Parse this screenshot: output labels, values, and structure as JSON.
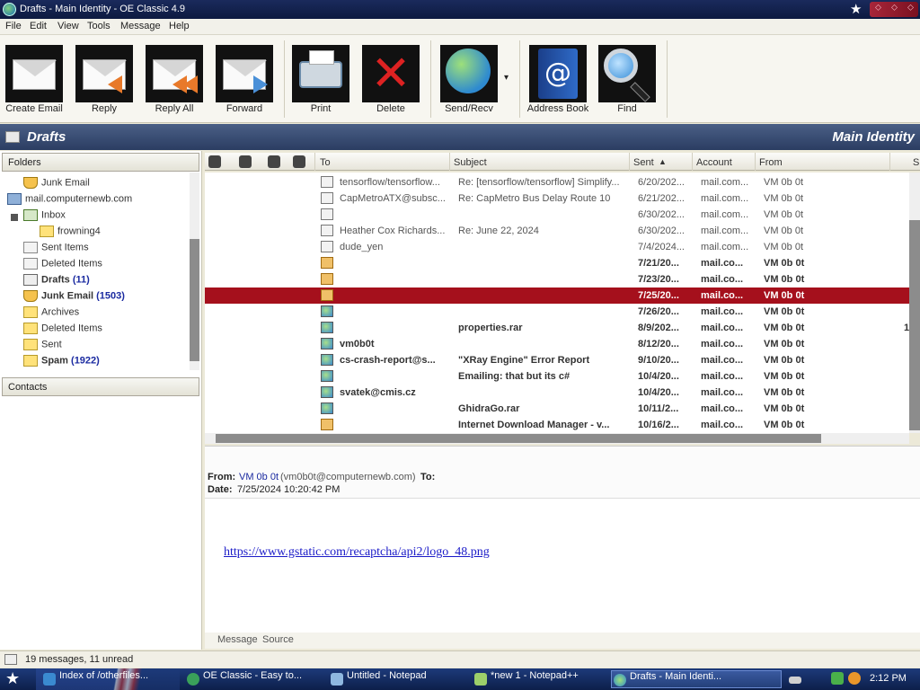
{
  "window": {
    "title": "Drafts - Main Identity - OE Classic 4.9",
    "star_glyph": "★",
    "controls": [
      "⬦",
      "⬦",
      "⬦"
    ]
  },
  "menu": [
    "File",
    "Edit",
    "View",
    "Tools",
    "Message",
    "Help"
  ],
  "toolbar": {
    "create_email": "Create Email",
    "reply": "Reply",
    "reply_all": "Reply All",
    "forward": "Forward",
    "print": "Print",
    "delete": "Delete",
    "send_recv": "Send/Recv",
    "address_book": "Address Book",
    "find": "Find",
    "dropdown_glyph": "▾"
  },
  "header": {
    "folder_title": "Drafts",
    "identity": "Main Identity"
  },
  "folders_pane": {
    "title": "Folders",
    "items": [
      {
        "label": "Junk Email",
        "count": "",
        "icon": "junk-icon",
        "bold": false
      },
      {
        "label": "mail.computernewb.com",
        "count": "",
        "icon": "server-icon",
        "bold": false
      },
      {
        "label": "Inbox",
        "count": "",
        "icon": "inbox-icon",
        "bold": false
      },
      {
        "label": "frowning4",
        "count": "",
        "icon": "folder-icon",
        "bold": false
      },
      {
        "label": "Sent Items",
        "count": "",
        "icon": "sent-icon",
        "bold": false
      },
      {
        "label": "Deleted Items",
        "count": "",
        "icon": "deleted-icon",
        "bold": false
      },
      {
        "label": "Drafts",
        "count": "(11)",
        "icon": "drafts-icon",
        "bold": true
      },
      {
        "label": "Junk Email",
        "count": "(1503)",
        "icon": "junk-icon",
        "bold": true
      },
      {
        "label": "Archives",
        "count": "",
        "icon": "folder-icon",
        "bold": false
      },
      {
        "label": "Deleted Items",
        "count": "",
        "icon": "folder-icon",
        "bold": false
      },
      {
        "label": "Sent",
        "count": "",
        "icon": "folder-icon",
        "bold": false
      },
      {
        "label": "Spam",
        "count": "(1922)",
        "icon": "folder-icon",
        "bold": true
      }
    ]
  },
  "contacts_pane": {
    "title": "Contacts"
  },
  "list_header": {
    "to": "To",
    "subject": "Subject",
    "sent": "Sent",
    "sort_glyph": "▲",
    "account": "Account",
    "from": "From",
    "extra": "S"
  },
  "messages": [
    {
      "to": "tensorflow/tensorflow...",
      "subject": "Re: [tensorflow/tensorflow] Simplify...",
      "sent": "6/20/202...",
      "account": "mail.com...",
      "from": "VM 0b 0t",
      "unread": false,
      "icon": "draft-icon"
    },
    {
      "to": "CapMetroATX@subsc...",
      "subject": "Re: CapMetro Bus Delay Route 10",
      "sent": "6/21/202...",
      "account": "mail.com...",
      "from": "VM 0b 0t",
      "unread": false,
      "icon": "draft-icon"
    },
    {
      "to": "",
      "subject": "",
      "sent": "6/30/202...",
      "account": "mail.com...",
      "from": "VM 0b 0t",
      "unread": false,
      "icon": "draft-icon"
    },
    {
      "to": "Heather Cox Richards...",
      "subject": "Re: June 22, 2024",
      "sent": "6/30/202...",
      "account": "mail.com...",
      "from": "VM 0b 0t",
      "unread": false,
      "icon": "draft-icon"
    },
    {
      "to": "dude_yen",
      "subject": "",
      "sent": "7/4/2024...",
      "account": "mail.com...",
      "from": "VM 0b 0t",
      "unread": false,
      "icon": "draft-icon"
    },
    {
      "to": "",
      "subject": "",
      "sent": "7/21/20...",
      "account": "mail.co...",
      "from": "VM 0b 0t",
      "unread": true,
      "icon": "closed-mail-icon"
    },
    {
      "to": "",
      "subject": "",
      "sent": "7/23/20...",
      "account": "mail.co...",
      "from": "VM 0b 0t",
      "unread": true,
      "icon": "closed-mail-icon"
    },
    {
      "to": "",
      "subject": "",
      "sent": "7/25/20...",
      "account": "mail.co...",
      "from": "VM 0b 0t",
      "unread": true,
      "icon": "closed-mail-icon",
      "selected": true
    },
    {
      "to": "",
      "subject": "",
      "sent": "7/26/20...",
      "account": "mail.co...",
      "from": "VM 0b 0t",
      "unread": true,
      "icon": "globe-mail-icon"
    },
    {
      "to": "",
      "subject": "properties.rar",
      "sent": "8/9/202...",
      "account": "mail.co...",
      "from": "VM 0b 0t",
      "unread": true,
      "icon": "globe-mail-icon",
      "extra": "1"
    },
    {
      "to": "vm0b0t",
      "subject": "",
      "sent": "8/12/20...",
      "account": "mail.co...",
      "from": "VM 0b 0t",
      "unread": true,
      "icon": "globe-mail-icon"
    },
    {
      "to": "cs-crash-report@s...",
      "subject": "\"XRay Engine\" Error Report",
      "sent": "9/10/20...",
      "account": "mail.co...",
      "from": "VM 0b 0t",
      "unread": true,
      "icon": "globe-mail-icon"
    },
    {
      "to": "",
      "subject": "Emailing: that but its c#",
      "sent": "10/4/20...",
      "account": "mail.co...",
      "from": "VM 0b 0t",
      "unread": true,
      "icon": "globe-mail-icon"
    },
    {
      "to": "svatek@cmis.cz",
      "subject": "",
      "sent": "10/4/20...",
      "account": "mail.co...",
      "from": "VM 0b 0t",
      "unread": true,
      "icon": "globe-mail-icon"
    },
    {
      "to": "",
      "subject": "GhidraGo.rar",
      "sent": "10/11/2...",
      "account": "mail.co...",
      "from": "VM 0b 0t",
      "unread": true,
      "icon": "globe-mail-icon"
    },
    {
      "to": "",
      "subject": "Internet Download Manager - v...",
      "sent": "10/16/2...",
      "account": "mail.co...",
      "from": "VM 0b 0t",
      "unread": true,
      "icon": "closed-mail-icon"
    }
  ],
  "preview": {
    "from_label": "From:",
    "from_name": "VM 0b 0t",
    "from_email": "(vm0b0t@computernewb.com)",
    "to_label": "To:",
    "date_label": "Date:",
    "date_value": "7/25/2024 10:20:42 PM",
    "link": "https://www.gstatic.com/recaptcha/api2/logo_48.png",
    "tab_message": "Message",
    "tab_source": "Source"
  },
  "status": {
    "text": "19 messages, 11 unread"
  },
  "taskbar": {
    "start_glyph": "★",
    "tasks": [
      {
        "label": "Index of /otherfiles..."
      },
      {
        "label": "OE Classic - Easy to..."
      },
      {
        "label": "Untitled - Notepad"
      },
      {
        "label": "*new 1 - Notepad++"
      },
      {
        "label": "Drafts - Main Identi..."
      }
    ],
    "clock": "2:12 PM"
  },
  "colors": {
    "selected_row": "#a5101c",
    "header_band": "#2b3d62",
    "link": "#1b1bc8"
  }
}
